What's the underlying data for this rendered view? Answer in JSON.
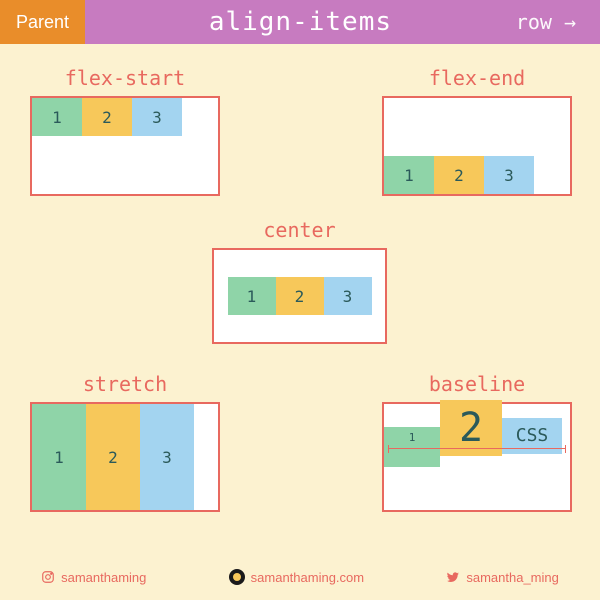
{
  "header": {
    "badge": "Parent",
    "title": "align-items",
    "direction": "row →"
  },
  "examples": {
    "flex_start": {
      "label": "flex-start",
      "items": [
        "1",
        "2",
        "3"
      ]
    },
    "flex_end": {
      "label": "flex-end",
      "items": [
        "1",
        "2",
        "3"
      ]
    },
    "center": {
      "label": "center",
      "items": [
        "1",
        "2",
        "3"
      ]
    },
    "stretch": {
      "label": "stretch",
      "items": [
        "1",
        "2",
        "3"
      ]
    },
    "baseline": {
      "label": "baseline",
      "items": [
        "1",
        "2",
        "CSS"
      ]
    }
  },
  "colors": {
    "bg": "#fcf2d0",
    "accent": "#e8695f",
    "header_bg": "#c77bc0",
    "badge_bg": "#e98d2a",
    "item1": "#8fd4a8",
    "item2": "#f7c85a",
    "item3": "#a3d4f0"
  },
  "footer": {
    "instagram": "samanthaming",
    "web": "samanthaming.com",
    "twitter": "samantha_ming"
  }
}
